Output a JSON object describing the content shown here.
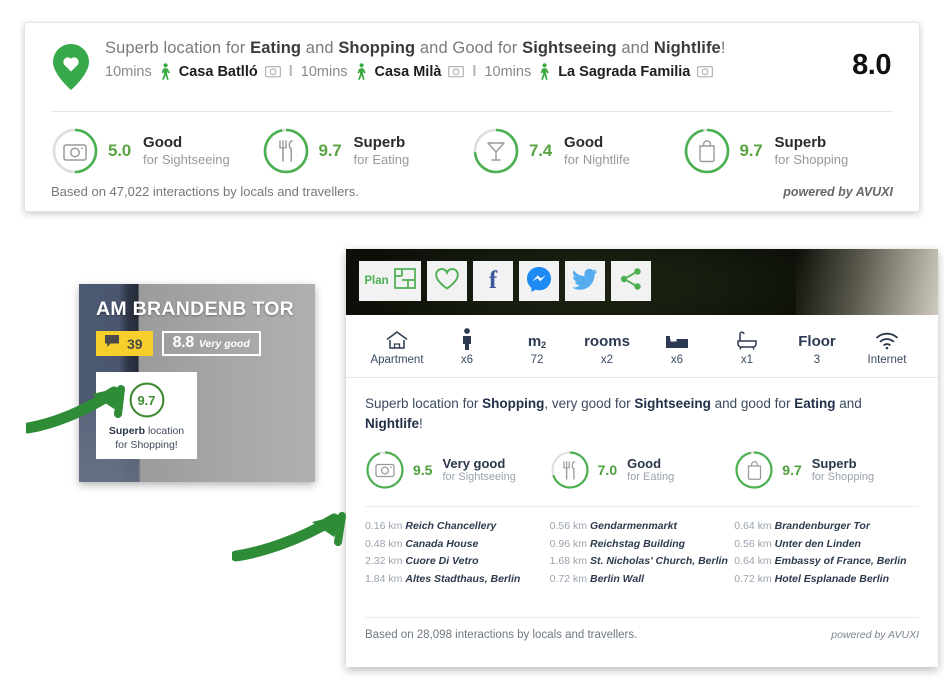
{
  "top_panel": {
    "pin_icon": "heart-location-pin-icon",
    "headline": {
      "prefix": "Superb location for ",
      "b1": "Eating",
      "mid1": " and ",
      "b2": "Shopping",
      "mid2": " and Good for ",
      "b3": "Sightseeing",
      "mid3": " and ",
      "b4": "Nightlife",
      "suffix": "!"
    },
    "pois": [
      {
        "time": "10mins",
        "name": "Casa Batlló"
      },
      {
        "time": "10mins",
        "name": "Casa Milà"
      },
      {
        "time": "10mins",
        "name": "La Sagrada Familia"
      }
    ],
    "separator": "l",
    "overall_score": "8.0",
    "scores": [
      {
        "icon": "camera-icon",
        "value": "5.0",
        "label": "Good",
        "sub": "for Sightseeing",
        "pct": 50
      },
      {
        "icon": "cutlery-icon",
        "value": "9.7",
        "label": "Superb",
        "sub": "for Eating",
        "pct": 97
      },
      {
        "icon": "cocktail-glass-icon",
        "value": "7.4",
        "label": "Good",
        "sub": "for Nightlife",
        "pct": 74
      },
      {
        "icon": "shopping-bag-icon",
        "value": "9.7",
        "label": "Superb",
        "sub": "for Shopping",
        "pct": 97
      }
    ],
    "based_on": "Based on 47,022 interactions by locals and travellers.",
    "powered_by": "powered by AVUXI"
  },
  "photo_card": {
    "title": "AM BRANDENB TOR",
    "reviews_icon": "speech-bubble-icon",
    "reviews_count": "39",
    "rating_value": "8.8",
    "rating_label": "Very good",
    "mini": {
      "score": "9.7",
      "line1_bold": "Superb",
      "line1_rest": " location",
      "line2": "for Shopping!"
    }
  },
  "right_panel": {
    "toolbar": [
      {
        "name": "plan-button",
        "label": "Plan",
        "icon": "floorplan-icon"
      },
      {
        "name": "favourite-button",
        "label": "",
        "icon": "heart-outline-icon"
      },
      {
        "name": "facebook-share-button",
        "label": "f",
        "icon": "facebook-icon"
      },
      {
        "name": "messenger-share-button",
        "label": "",
        "icon": "messenger-icon"
      },
      {
        "name": "twitter-share-button",
        "label": "",
        "icon": "twitter-bird-icon"
      },
      {
        "name": "share-button",
        "label": "",
        "icon": "share-nodes-icon"
      }
    ],
    "specs": [
      {
        "icon": "house-icon",
        "top": "",
        "bottom": "Apartment"
      },
      {
        "icon": "person-icon",
        "top": "",
        "bottom": "x6"
      },
      {
        "icon": "",
        "top": "m2",
        "bottom": "72"
      },
      {
        "icon": "",
        "top": "rooms",
        "bottom": "x2"
      },
      {
        "icon": "bed-icon",
        "top": "",
        "bottom": "x6"
      },
      {
        "icon": "bathtub-icon",
        "top": "",
        "bottom": "x1"
      },
      {
        "icon": "",
        "top": "Floor",
        "bottom": "3"
      },
      {
        "icon": "wifi-icon",
        "top": "",
        "bottom": "Internet"
      }
    ],
    "description": {
      "p1": "Superb location for ",
      "b1": "Shopping",
      "p2": ", very good for ",
      "b2": "Sightseeing",
      "p3": " and good for ",
      "b3": "Eating",
      "p4": " and ",
      "b4": "Nightlife",
      "p5": "!"
    },
    "scores": [
      {
        "icon": "camera-icon",
        "value": "9.5",
        "label": "Very good",
        "sub": "for Sightseeing",
        "pct": 95
      },
      {
        "icon": "cutlery-icon",
        "value": "7.0",
        "label": "Good",
        "sub": "for Eating",
        "pct": 70
      },
      {
        "icon": "shopping-bag-icon",
        "value": "9.7",
        "label": "Superb",
        "sub": "for Shopping",
        "pct": 97
      }
    ],
    "poi_columns": [
      [
        {
          "dist": "0.16 km",
          "name": "Reich Chancellery"
        },
        {
          "dist": "0.48 km",
          "name": "Canada House"
        },
        {
          "dist": "2.32 km",
          "name": "Cuore Di Vetro"
        },
        {
          "dist": "1.84 km",
          "name": "Altes Stadthaus, Berlin"
        }
      ],
      [
        {
          "dist": "0.56 km",
          "name": "Gendarmenmarkt"
        },
        {
          "dist": "0.96 km",
          "name": "Reichstag Building"
        },
        {
          "dist": "1.68 km",
          "name": "St. Nicholas' Church, Berlin"
        },
        {
          "dist": "0.72 km",
          "name": "Berlin Wall"
        }
      ],
      [
        {
          "dist": "0.64 km",
          "name": "Brandenburger Tor"
        },
        {
          "dist": "0.56 km",
          "name": "Unter den Linden"
        },
        {
          "dist": "0.64 km",
          "name": "Embassy of France, Berlin"
        },
        {
          "dist": "0.72 km",
          "name": "Hotel Esplanade Berlin"
        }
      ]
    ],
    "based_on": "Based on 28,098 interactions by locals and travellers.",
    "powered_by": "powered by AVUXI"
  },
  "annotations": {
    "arrow_1": "green-arrow-icon",
    "arrow_2": "green-arrow-icon"
  },
  "colors": {
    "green": "#4caf50",
    "green_dark": "#3f8a32",
    "score_green": "#58a442",
    "yellow": "#f6cf2c",
    "navy": "#2c3a52",
    "facebook_blue": "#3b5998",
    "messenger_blue": "#1e8bf5",
    "twitter_blue": "#55acee",
    "arrow_green": "#2e8b36"
  }
}
